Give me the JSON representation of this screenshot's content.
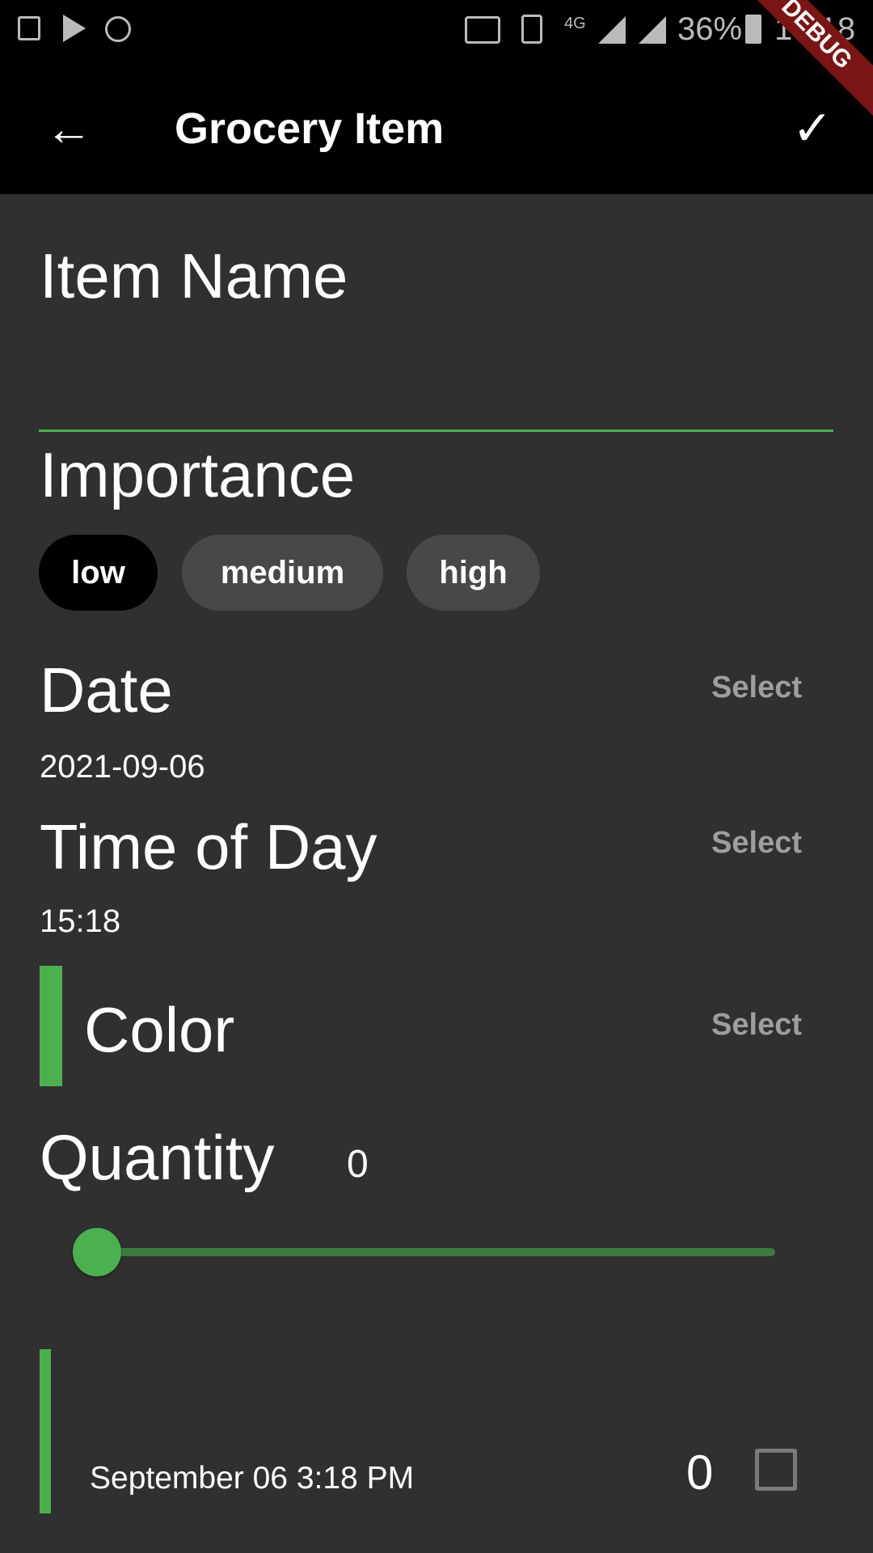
{
  "status_bar": {
    "battery": "36%",
    "time": "15:18",
    "network": "4G"
  },
  "debug_banner": "DEBUG",
  "app_bar": {
    "title": "Grocery Item"
  },
  "form": {
    "item_name_label": "Item Name",
    "item_name_value": "",
    "importance_label": "Importance",
    "importance_options": [
      "low",
      "medium",
      "high"
    ],
    "importance_selected": "low",
    "date_label": "Date",
    "date_select": "Select",
    "date_value": "2021-09-06",
    "time_label": "Time of Day",
    "time_select": "Select",
    "time_value": "15:18",
    "color_label": "Color",
    "color_select": "Select",
    "color_value": "#4CAF50",
    "quantity_label": "Quantity",
    "quantity_value": "0",
    "quantity_fraction": 0
  },
  "preview": {
    "date_text": "September 06 3:18 PM",
    "quantity": "0",
    "checked": false
  },
  "colors": {
    "accent": "#4CAF50",
    "background": "#303030"
  }
}
